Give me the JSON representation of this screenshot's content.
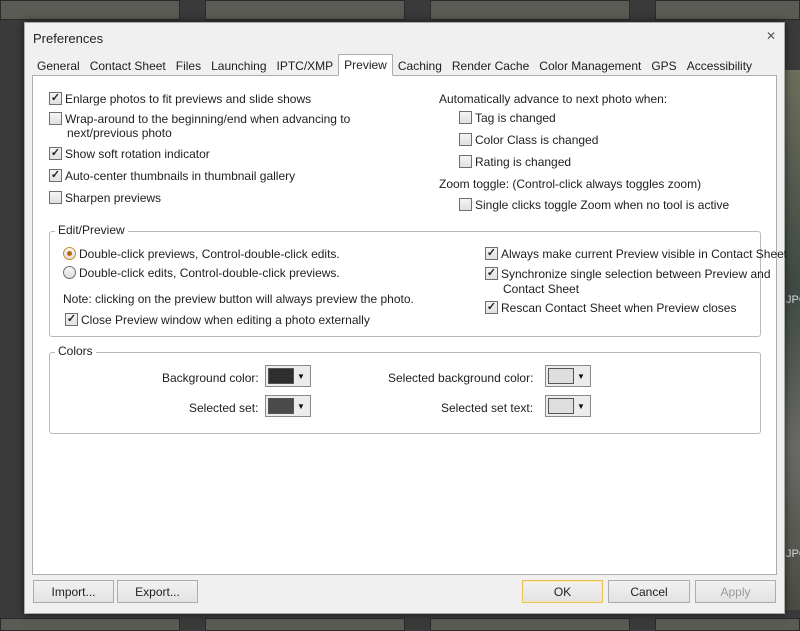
{
  "background": {
    "side_labels": [
      "JPG",
      "JPG"
    ]
  },
  "dialog": {
    "title": "Preferences",
    "close_glyph": "✕"
  },
  "tabs": [
    {
      "label": "General"
    },
    {
      "label": "Contact Sheet"
    },
    {
      "label": "Files"
    },
    {
      "label": "Launching"
    },
    {
      "label": "IPTC/XMP"
    },
    {
      "label": "Preview",
      "active": true
    },
    {
      "label": "Caching"
    },
    {
      "label": "Render Cache"
    },
    {
      "label": "Color Management"
    },
    {
      "label": "GPS"
    },
    {
      "label": "Accessibility"
    }
  ],
  "left_options": [
    {
      "label": "Enlarge photos to fit previews and slide shows",
      "checked": true
    },
    {
      "label": "Wrap-around to the beginning/end when advancing to",
      "label2": "next/previous photo",
      "checked": false
    },
    {
      "label": "Show soft rotation indicator",
      "checked": true
    },
    {
      "label": "Auto-center thumbnails in thumbnail gallery",
      "checked": true
    },
    {
      "label": "Sharpen previews",
      "checked": false
    }
  ],
  "auto_advance": {
    "heading": "Automatically advance to next photo when:",
    "items": [
      {
        "label": "Tag is changed",
        "checked": false
      },
      {
        "label": "Color Class is changed",
        "checked": false
      },
      {
        "label": "Rating is changed",
        "checked": false
      }
    ]
  },
  "zoom": {
    "heading": "Zoom toggle: (Control-click always toggles zoom)",
    "option": {
      "label": "Single clicks toggle Zoom when no tool is active",
      "checked": false
    }
  },
  "edit_preview": {
    "legend": "Edit/Preview",
    "radios": [
      {
        "label": "Double-click previews, Control-double-click edits.",
        "checked": true
      },
      {
        "label": "Double-click edits, Control-double-click previews.",
        "checked": false
      }
    ],
    "note": "Note: clicking on the preview button will always preview the photo.",
    "close_preview": {
      "label": "Close Preview window when editing a photo externally",
      "checked": true
    },
    "right_options": [
      {
        "label": "Always make current Preview visible in Contact Sheet",
        "checked": true
      },
      {
        "label": "Synchronize single selection between Preview and",
        "label2": "Contact Sheet",
        "checked": true
      },
      {
        "label": "Rescan Contact Sheet when Preview closes",
        "checked": true
      }
    ]
  },
  "colors": {
    "legend": "Colors",
    "background_label": "Background color:",
    "background_color": "#2e2e2e",
    "selected_set_label": "Selected set:",
    "selected_set_color": "#4a4a4a",
    "selected_background_label": "Selected background color:",
    "selected_background_color": "#dedede",
    "selected_set_text_label": "Selected set text:",
    "selected_set_text_color": "#dedede",
    "dropdown_glyph": "▼"
  },
  "buttons": {
    "import": "Import...",
    "export": "Export...",
    "ok": "OK",
    "cancel": "Cancel",
    "apply": "Apply"
  }
}
